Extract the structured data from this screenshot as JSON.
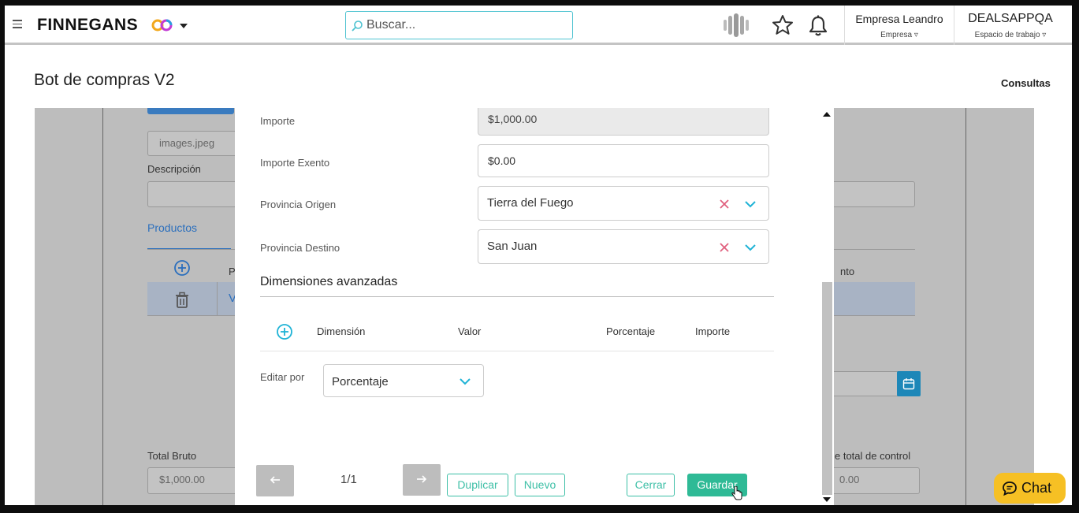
{
  "header": {
    "brand": "FINNEGANS",
    "search_placeholder": "Buscar...",
    "company": {
      "value": "Empresa Leandro",
      "label": "Empresa"
    },
    "workspace": {
      "value": "DEALSAPPQA",
      "label": "Espacio de trabajo"
    }
  },
  "page": {
    "title": "Bot de compras V2",
    "consultas_label": "Consultas"
  },
  "background_form": {
    "attachment_name": "images.jpeg",
    "description_label": "Descripción",
    "tab_products": "Productos",
    "column_fragment_p": "P",
    "column_fragment_v": "V",
    "column_fragment_nto": "nto",
    "total_bruto_label": "Total Bruto",
    "total_bruto_value": "$1,000.00",
    "total_control_label": "e total de control",
    "total_control_value": "0.00"
  },
  "modal": {
    "fields": {
      "importe": {
        "label": "Importe",
        "value": "$1,000.00"
      },
      "importe_exento": {
        "label": "Importe Exento",
        "value": "$0.00"
      },
      "provincia_origen": {
        "label": "Provincia Origen",
        "value": "Tierra del Fuego"
      },
      "provincia_destino": {
        "label": "Provincia Destino",
        "value": "San Juan"
      }
    },
    "section_title": "Dimensiones avanzadas",
    "dimension_columns": [
      "Dimensión",
      "Valor",
      "Porcentaje",
      "Importe"
    ],
    "editar_por": {
      "label": "Editar por",
      "value": "Porcentaje"
    },
    "pager": "1/1",
    "buttons": {
      "duplicar": "Duplicar",
      "nuevo": "Nuevo",
      "cerrar": "Cerrar",
      "guardar": "Guardar"
    }
  },
  "chat": {
    "label": "Chat"
  },
  "colors": {
    "accent_teal": "#3cbfa6",
    "search_border": "#4fc3d1",
    "clear_red": "#e0607e",
    "chevron_cyan": "#1fb3d6",
    "chat_yellow": "#f6c024"
  }
}
